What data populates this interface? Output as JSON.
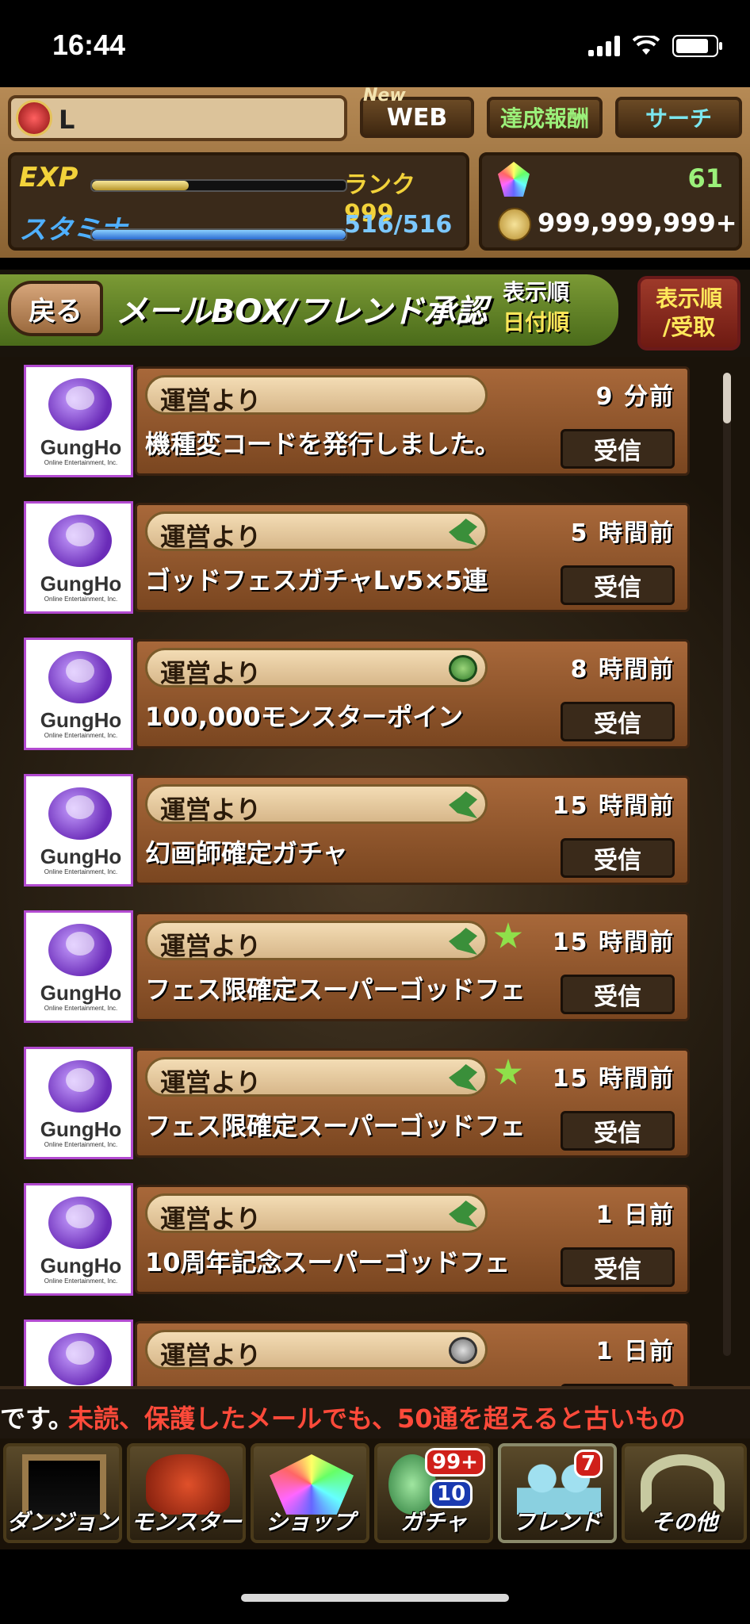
{
  "status": {
    "time": "16:44"
  },
  "header": {
    "player_name": "L",
    "web_new": "New",
    "web_label": "WEB",
    "achievements_label": "達成報酬",
    "search_label": "サーチ",
    "exp_label": "EXP",
    "rank_text": "ランク 999",
    "stamina_label": "スタミナ",
    "stamina_value": "516/516",
    "exp_fraction": 0.38,
    "stamina_fraction": 1.0,
    "magic_stones": "61",
    "coins": "999,999,999+"
  },
  "titlebar": {
    "back_label": "戻る",
    "title": "メールBOX/フレンド承認",
    "sort_label": "表示順",
    "sort_value": "日付順",
    "sort_button_line1": "表示順",
    "sort_button_line2": "/受取"
  },
  "mails": [
    {
      "from": "運営より",
      "icon": "none",
      "star": false,
      "when": "9 分前",
      "subject": "機種変コードを発行しました。",
      "button": "受信"
    },
    {
      "from": "運営より",
      "icon": "dragon-icon",
      "star": false,
      "when": "5 時間前",
      "subject": "ゴッドフェスガチャLv5×5連",
      "button": "受信"
    },
    {
      "from": "運営より",
      "icon": "monster-point-icon",
      "star": false,
      "when": "8 時間前",
      "subject": "100,000モンスターポイン",
      "button": "受信"
    },
    {
      "from": "運営より",
      "icon": "dragon-icon",
      "star": false,
      "when": "15 時間前",
      "subject": "幻画師確定ガチャ",
      "button": "受信"
    },
    {
      "from": "運営より",
      "icon": "dragon-icon",
      "star": true,
      "when": "15 時間前",
      "subject": "フェス限確定スーパーゴッドフェ",
      "button": "受信"
    },
    {
      "from": "運営より",
      "icon": "dragon-icon",
      "star": true,
      "when": "15 時間前",
      "subject": "フェス限確定スーパーゴッドフェ",
      "button": "受信"
    },
    {
      "from": "運営より",
      "icon": "dragon-icon",
      "star": false,
      "when": "1 日前",
      "subject": "10周年記念スーパーゴッドフェ",
      "button": "受信"
    },
    {
      "from": "運営より",
      "icon": "silver-coin-icon",
      "star": false,
      "when": "1 日前",
      "subject": "",
      "button": ""
    }
  ],
  "logo": {
    "text": "GungHo",
    "sub": "Online Entertainment, Inc."
  },
  "ticker": {
    "lead": "です。",
    "message": "未読、保護したメールでも、50通を超えると古いもの"
  },
  "nav": {
    "dungeon": "ダンジョン",
    "monster": "モンスター",
    "shop": "ショップ",
    "gacha": "ガチャ",
    "gacha_badge1": "99+",
    "gacha_badge2": "10",
    "friend": "フレンド",
    "friend_badge": "7",
    "other": "その他"
  },
  "colors": {
    "accent_green": "#9bf07a",
    "accent_cyan": "#7be6ef",
    "alert_red": "#ff4a3a",
    "rank_yellow": "#f2d23a",
    "logo_purple": "#b24ad0"
  }
}
